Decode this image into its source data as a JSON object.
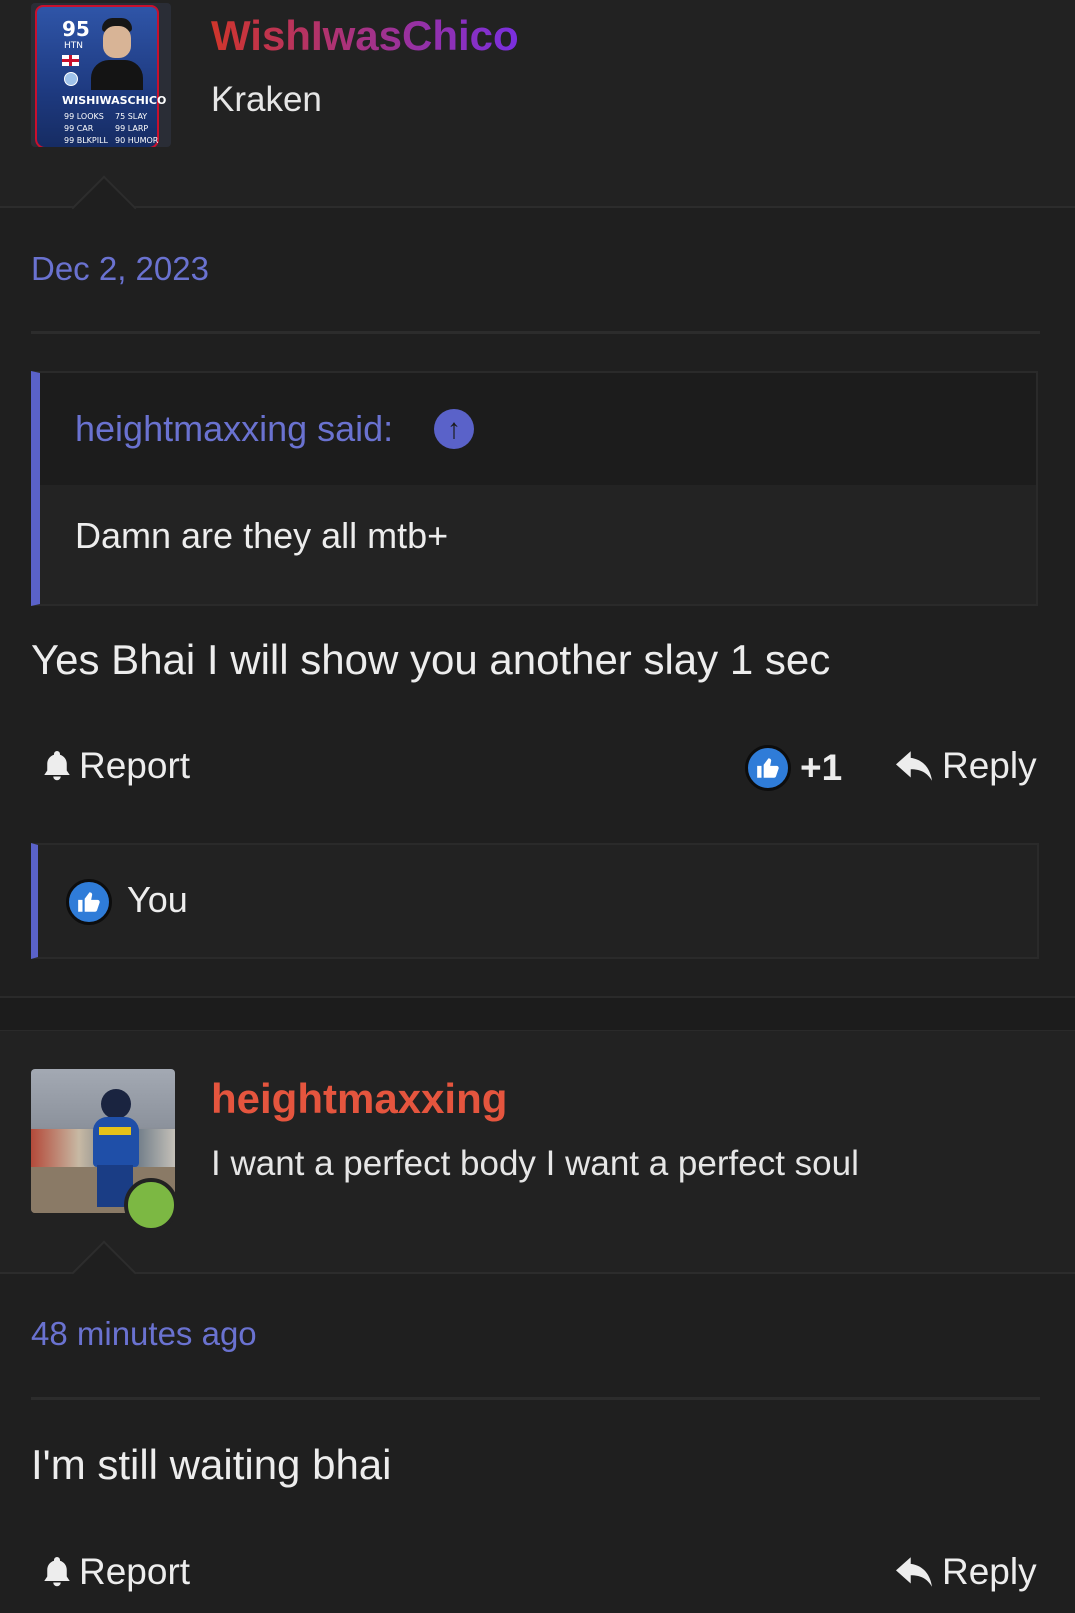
{
  "posts": [
    {
      "user": {
        "name": "WishIwasChico",
        "title": "Kraken",
        "avatar_card": {
          "rating": "95",
          "position": "HTN",
          "name": "WISHIWASCHICO",
          "stats": [
            "99 LOOKS",
            "75 SLAY",
            "99 CAR",
            "99 LARP",
            "99 BLKPILL",
            "90 HUMOR"
          ]
        },
        "name_color_start": "#d0352b",
        "name_color_end": "#7a2fe0"
      },
      "date": "Dec 2, 2023",
      "quote": {
        "author": "heightmaxxing said:",
        "text": "Damn are they all mtb+"
      },
      "message": "Yes Bhai I will show you another slay 1 sec",
      "actions": {
        "report": "Report",
        "likes": "+1",
        "reply": "Reply"
      },
      "liked_by": "You"
    },
    {
      "user": {
        "name": "heightmaxxing",
        "title": "I want a perfect body I want a perfect soul",
        "name_color": "#e5553e",
        "online": true
      },
      "date": "48 minutes ago",
      "message": "I'm still waiting bhai",
      "actions": {
        "report": "Report",
        "reply": "Reply"
      }
    }
  ],
  "colors": {
    "accent": "#5a62c9",
    "like_blue": "#2f7cd8",
    "online_green": "#7cb843"
  }
}
